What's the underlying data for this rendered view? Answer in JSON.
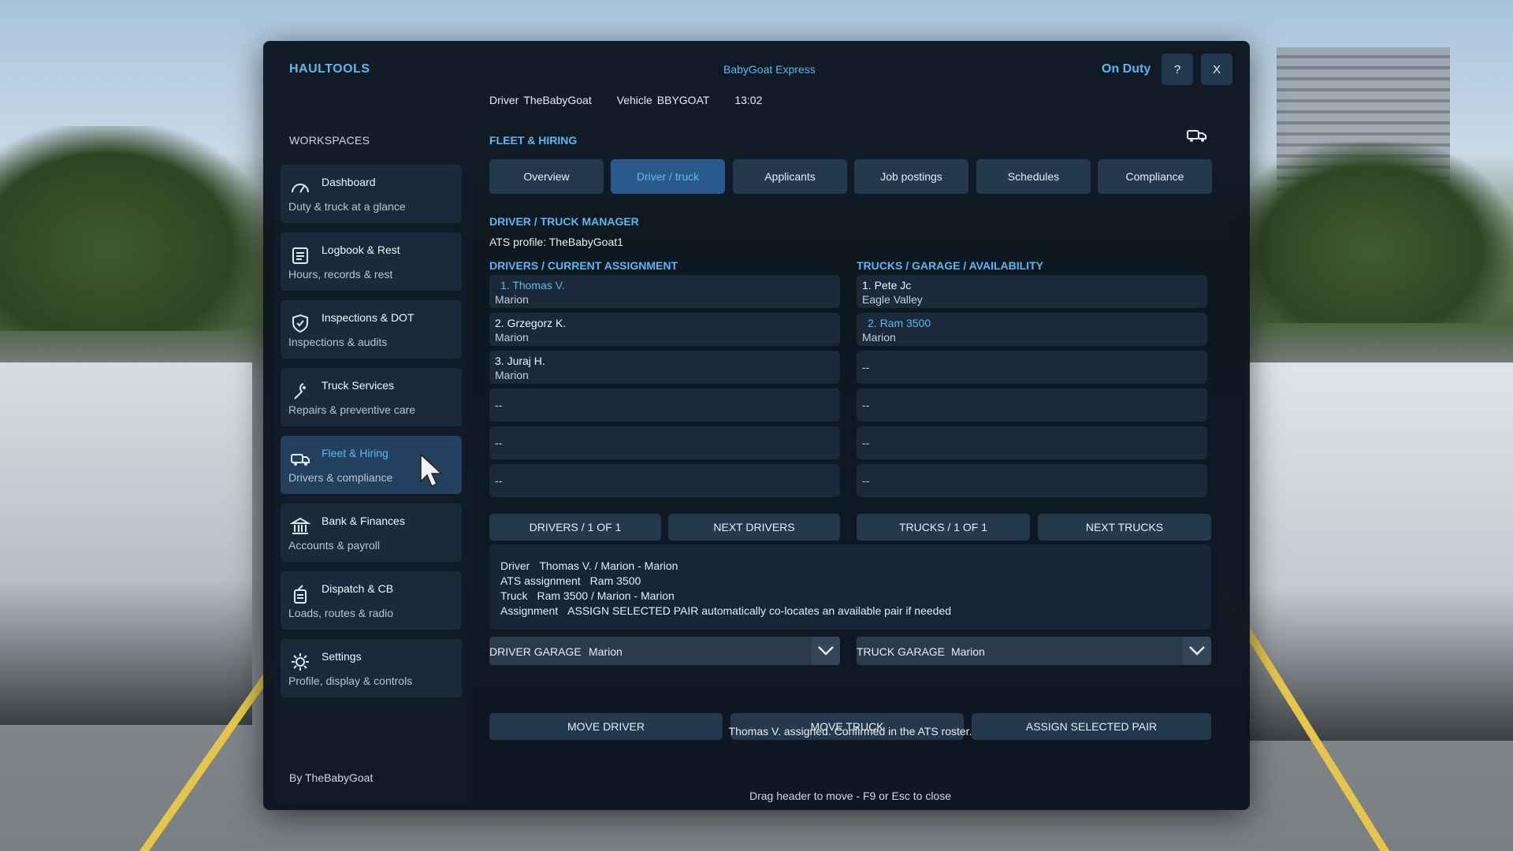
{
  "window": {
    "app_title": "HAULTOOLS",
    "company": "BabyGoat Express",
    "status": "On Duty",
    "help_label": "?",
    "close_label": "X",
    "driver_label": "Driver",
    "driver_value": "TheBabyGoat",
    "vehicle_label": "Vehicle",
    "vehicle_value": "BBYGOAT",
    "time": "13:02"
  },
  "sidebar": {
    "title": "WORKSPACES",
    "items": [
      {
        "label": "Dashboard",
        "sub": "Duty & truck at a glance",
        "icon": "gauge-icon"
      },
      {
        "label": "Logbook & Rest",
        "sub": "Hours, records & rest",
        "icon": "logbook-icon"
      },
      {
        "label": "Inspections & DOT",
        "sub": "Inspections & audits",
        "icon": "shield-check-icon"
      },
      {
        "label": "Truck Services",
        "sub": "Repairs & preventive care",
        "icon": "wrench-icon"
      },
      {
        "label": "Fleet & Hiring",
        "sub": "Drivers & compliance",
        "icon": "truck-icon"
      },
      {
        "label": "Bank & Finances",
        "sub": "Accounts & payroll",
        "icon": "bank-icon"
      },
      {
        "label": "Dispatch & CB",
        "sub": "Loads, routes & radio",
        "icon": "radio-icon"
      },
      {
        "label": "Settings",
        "sub": "Profile, display & controls",
        "icon": "gear-icon"
      }
    ],
    "byline": "By TheBabyGoat"
  },
  "main": {
    "section_title": "FLEET & HIRING",
    "tabs": [
      "Overview",
      "Driver / truck",
      "Applicants",
      "Job postings",
      "Schedules",
      "Compliance"
    ],
    "manager_title": "DRIVER / TRUCK MANAGER",
    "profile": "ATS profile: TheBabyGoat1",
    "drivers_title": "DRIVERS / CURRENT ASSIGNMENT",
    "trucks_title": "TRUCKS / GARAGE / AVAILABILITY",
    "drivers": [
      {
        "name": "1. Thomas V.",
        "loc": "Marion"
      },
      {
        "name": "2. Grzegorz K.",
        "loc": "Marion"
      },
      {
        "name": "3. Juraj H.",
        "loc": "Marion"
      },
      {
        "empty": "--"
      },
      {
        "empty": "--"
      },
      {
        "empty": "--"
      }
    ],
    "trucks": [
      {
        "name": "1. Pete Jc",
        "loc": "Eagle Valley"
      },
      {
        "name": "2. Ram 3500",
        "loc": "Marion"
      },
      {
        "empty": "--"
      },
      {
        "empty": "--"
      },
      {
        "empty": "--"
      },
      {
        "empty": "--"
      }
    ],
    "pager": {
      "drivers_page": "DRIVERS / 1 OF 1",
      "next_drivers": "NEXT DRIVERS",
      "trucks_page": "TRUCKS / 1 OF 1",
      "next_trucks": "NEXT TRUCKS"
    },
    "info": {
      "driver_label": "Driver",
      "driver_value": "Thomas V. / Marion -  Marion",
      "ats_label": "ATS assignment",
      "ats_value": "Ram 3500",
      "truck_label": "Truck",
      "truck_value": "Ram 3500 / Marion -  Marion",
      "assignment_label": "Assignment",
      "assignment_value": "ASSIGN SELECTED PAIR automatically co-locates an available pair if needed"
    },
    "driver_garage_label": "DRIVER GARAGE",
    "driver_garage_value": "Marion",
    "truck_garage_label": "TRUCK GARAGE",
    "truck_garage_value": "Marion",
    "actions": {
      "move_driver": "MOVE DRIVER",
      "move_truck": "MOVE TRUCK",
      "assign_pair": "ASSIGN SELECTED PAIR"
    },
    "confirmation": "Thomas V. assigned. Confirmed in the ATS roster.",
    "hint": "Drag header to move - F9 or Esc to close"
  }
}
